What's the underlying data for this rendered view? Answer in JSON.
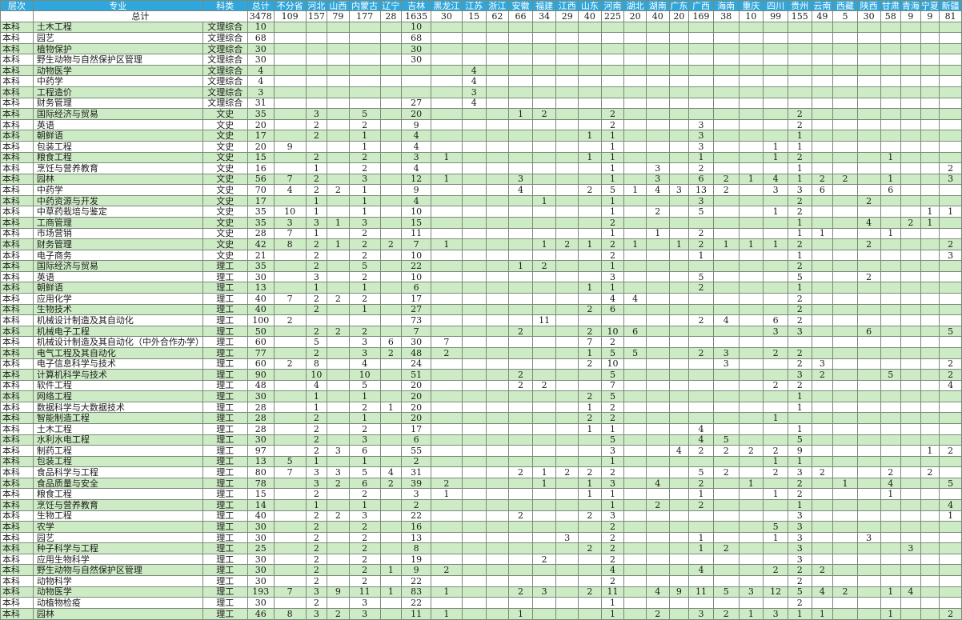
{
  "table": {
    "headers": [
      "层次",
      "专业",
      "科类",
      "总计",
      "不分省",
      "河北",
      "山西",
      "内蒙古",
      "辽宁",
      "吉林",
      "黑龙江",
      "江苏",
      "浙江",
      "安徽",
      "福建",
      "江西",
      "山东",
      "河南",
      "湖北",
      "湖南",
      "广东",
      "广西",
      "海南",
      "重庆",
      "四川",
      "贵州",
      "云南",
      "西藏",
      "陕西",
      "甘肃",
      "青海",
      "宁夏",
      "新疆"
    ],
    "total_label": "总计",
    "total_values": [
      "3478",
      "109",
      "157",
      "79",
      "177",
      "28",
      "1635",
      "30",
      "15",
      "62",
      "66",
      "34",
      "29",
      "40",
      "225",
      "20",
      "40",
      "20",
      "169",
      "38",
      "10",
      "99",
      "155",
      "49",
      "5",
      "30",
      "58",
      "9",
      "9",
      "81"
    ],
    "rows": [
      {
        "level": "本科",
        "major": "土木工程",
        "kind": "文理综合",
        "v": {
          "0": "10",
          "6": "10"
        }
      },
      {
        "level": "本科",
        "major": "园艺",
        "kind": "文理综合",
        "v": {
          "0": "68",
          "6": "68"
        }
      },
      {
        "level": "本科",
        "major": "植物保护",
        "kind": "文理综合",
        "v": {
          "0": "30",
          "6": "30"
        }
      },
      {
        "level": "本科",
        "major": "野生动物与自然保护区管理",
        "kind": "文理综合",
        "v": {
          "0": "30",
          "6": "30"
        }
      },
      {
        "level": "本科",
        "major": "动物医学",
        "kind": "文理综合",
        "v": {
          "0": "4",
          "8": "4"
        }
      },
      {
        "level": "本科",
        "major": "中药学",
        "kind": "文理综合",
        "v": {
          "0": "4",
          "8": "4"
        }
      },
      {
        "level": "本科",
        "major": "工程造价",
        "kind": "文理综合",
        "v": {
          "0": "3",
          "8": "3"
        }
      },
      {
        "level": "本科",
        "major": "财务管理",
        "kind": "文理综合",
        "v": {
          "0": "31",
          "6": "27",
          "8": "4"
        }
      },
      {
        "level": "本科",
        "major": "国际经济与贸易",
        "kind": "文史",
        "v": {
          "0": "35",
          "2": "3",
          "4": "5",
          "6": "20",
          "10": "1",
          "11": "2",
          "14": "2",
          "22": "2"
        }
      },
      {
        "level": "本科",
        "major": "英语",
        "kind": "文史",
        "v": {
          "0": "20",
          "2": "2",
          "4": "2",
          "6": "9",
          "14": "2",
          "18": "3",
          "22": "2"
        }
      },
      {
        "level": "本科",
        "major": "朝鲜语",
        "kind": "文史",
        "v": {
          "0": "17",
          "2": "2",
          "4": "1",
          "6": "4",
          "13": "1",
          "14": "1",
          "18": "3",
          "22": "1"
        }
      },
      {
        "level": "本科",
        "major": "包装工程",
        "kind": "文史",
        "v": {
          "0": "20",
          "1": "9",
          "4": "1",
          "6": "4",
          "14": "1",
          "18": "3",
          "21": "1",
          "22": "1"
        }
      },
      {
        "level": "本科",
        "major": "粮食工程",
        "kind": "文史",
        "v": {
          "0": "15",
          "2": "2",
          "4": "2",
          "6": "3",
          "7": "1",
          "13": "1",
          "14": "1",
          "18": "1",
          "21": "1",
          "22": "2",
          "26": "1"
        }
      },
      {
        "level": "本科",
        "major": "烹饪与营养教育",
        "kind": "文史",
        "v": {
          "0": "16",
          "2": "1",
          "4": "2",
          "6": "4",
          "14": "1",
          "16": "3",
          "18": "2",
          "22": "1",
          "29": "2"
        }
      },
      {
        "level": "本科",
        "major": "园林",
        "kind": "文史",
        "v": {
          "0": "56",
          "1": "7",
          "2": "2",
          "4": "3",
          "6": "12",
          "7": "1",
          "10": "3",
          "14": "1",
          "16": "3",
          "18": "6",
          "19": "2",
          "20": "1",
          "21": "4",
          "22": "1",
          "23": "2",
          "24": "2",
          "26": "1",
          "29": "3"
        }
      },
      {
        "level": "本科",
        "major": "中药学",
        "kind": "文史",
        "v": {
          "0": "70",
          "1": "4",
          "2": "2",
          "3": "2",
          "4": "1",
          "6": "9",
          "10": "4",
          "13": "2",
          "14": "5",
          "15": "1",
          "16": "4",
          "17": "3",
          "18": "13",
          "19": "2",
          "21": "3",
          "22": "3",
          "23": "6",
          "26": "6"
        }
      },
      {
        "level": "本科",
        "major": "中药资源与开发",
        "kind": "文史",
        "v": {
          "0": "17",
          "2": "1",
          "4": "1",
          "6": "4",
          "11": "1",
          "14": "1",
          "18": "3",
          "22": "2",
          "25": "2"
        }
      },
      {
        "level": "本科",
        "major": "中草药栽培与鉴定",
        "kind": "文史",
        "v": {
          "0": "35",
          "1": "10",
          "2": "1",
          "4": "1",
          "6": "10",
          "14": "1",
          "16": "2",
          "18": "5",
          "21": "1",
          "22": "2",
          "28": "1",
          "29": "1"
        }
      },
      {
        "level": "本科",
        "major": "工商管理",
        "kind": "文史",
        "v": {
          "0": "35",
          "1": "3",
          "2": "3",
          "3": "1",
          "4": "3",
          "6": "15",
          "14": "2",
          "22": "1",
          "25": "4",
          "27": "2",
          "28": "1"
        }
      },
      {
        "level": "本科",
        "major": "市场营销",
        "kind": "文史",
        "v": {
          "0": "28",
          "1": "7",
          "2": "1",
          "4": "2",
          "6": "11",
          "14": "1",
          "16": "1",
          "18": "2",
          "22": "1",
          "23": "1",
          "26": "1"
        }
      },
      {
        "level": "本科",
        "major": "财务管理",
        "kind": "文史",
        "v": {
          "0": "42",
          "1": "8",
          "2": "2",
          "3": "1",
          "4": "2",
          "5": "2",
          "6": "7",
          "7": "1",
          "11": "1",
          "12": "2",
          "13": "1",
          "14": "2",
          "15": "1",
          "17": "1",
          "18": "2",
          "19": "1",
          "20": "1",
          "21": "1",
          "22": "2",
          "25": "2",
          "29": "2"
        }
      },
      {
        "level": "本科",
        "major": "电子商务",
        "kind": "文史",
        "v": {
          "0": "21",
          "2": "2",
          "4": "2",
          "6": "10",
          "14": "2",
          "18": "1",
          "22": "1",
          "29": "3"
        }
      },
      {
        "level": "本科",
        "major": "国际经济与贸易",
        "kind": "理工",
        "v": {
          "0": "35",
          "2": "2",
          "4": "5",
          "6": "22",
          "10": "1",
          "11": "2",
          "14": "1",
          "22": "2"
        }
      },
      {
        "level": "本科",
        "major": "英语",
        "kind": "理工",
        "v": {
          "0": "30",
          "2": "3",
          "4": "2",
          "6": "10",
          "14": "3",
          "18": "5",
          "22": "5",
          "25": "2"
        }
      },
      {
        "level": "本科",
        "major": "朝鲜语",
        "kind": "理工",
        "v": {
          "0": "13",
          "2": "1",
          "4": "1",
          "6": "6",
          "13": "1",
          "14": "1",
          "18": "2",
          "22": "1"
        }
      },
      {
        "level": "本科",
        "major": "应用化学",
        "kind": "理工",
        "v": {
          "0": "40",
          "1": "7",
          "2": "2",
          "3": "2",
          "4": "2",
          "6": "17",
          "14": "4",
          "15": "4",
          "22": "2"
        }
      },
      {
        "level": "本科",
        "major": "生物技术",
        "kind": "理工",
        "v": {
          "0": "40",
          "2": "2",
          "4": "1",
          "6": "27",
          "13": "2",
          "14": "6",
          "22": "2"
        }
      },
      {
        "level": "本科",
        "major": "机械设计制造及其自动化",
        "kind": "理工",
        "v": {
          "0": "100",
          "1": "2",
          "6": "73",
          "11": "11",
          "18": "2",
          "19": "4",
          "21": "6",
          "22": "2"
        }
      },
      {
        "level": "本科",
        "major": "机械电子工程",
        "kind": "理工",
        "v": {
          "0": "50",
          "2": "2",
          "3": "2",
          "4": "2",
          "6": "7",
          "10": "2",
          "13": "2",
          "14": "10",
          "15": "6",
          "21": "3",
          "22": "3",
          "25": "6",
          "29": "5"
        }
      },
      {
        "level": "本科",
        "major": " 机械设计制造及其自动化（中外合作办学）",
        "kind": "理工",
        "v": {
          "0": "60",
          "2": "5",
          "4": "3",
          "5": "6",
          "6": "30",
          "7": "7",
          "13": "7",
          "14": "2"
        }
      },
      {
        "level": "本科",
        "major": "电气工程及其自动化",
        "kind": "理工",
        "v": {
          "0": "77",
          "2": "2",
          "4": "3",
          "5": "2",
          "6": "48",
          "7": "2",
          "13": "1",
          "14": "5",
          "15": "5",
          "18": "2",
          "19": "3",
          "21": "2",
          "22": "2"
        }
      },
      {
        "level": "本科",
        "major": "电子信息科学与技术",
        "kind": "理工",
        "v": {
          "0": "60",
          "1": "2",
          "2": "8",
          "4": "4",
          "6": "24",
          "13": "2",
          "14": "10",
          "19": "3",
          "22": "2",
          "23": "3",
          "29": "2"
        }
      },
      {
        "level": "本科",
        "major": "计算机科学与技术",
        "kind": "理工",
        "v": {
          "0": "90",
          "2": "10",
          "4": "10",
          "6": "51",
          "10": "2",
          "14": "5",
          "22": "3",
          "23": "2",
          "26": "5",
          "29": "2"
        }
      },
      {
        "level": "本科",
        "major": "软件工程",
        "kind": "理工",
        "v": {
          "0": "48",
          "2": "4",
          "4": "5",
          "6": "20",
          "10": "2",
          "11": "2",
          "14": "7",
          "21": "2",
          "22": "2",
          "29": "4"
        }
      },
      {
        "level": "本科",
        "major": "网络工程",
        "kind": "理工",
        "v": {
          "0": "30",
          "2": "1",
          "4": "1",
          "6": "20",
          "13": "2",
          "14": "5",
          "22": "1"
        }
      },
      {
        "level": "本科",
        "major": "数据科学与大数据技术",
        "kind": "理工",
        "v": {
          "0": "28",
          "2": "1",
          "4": "2",
          "5": "1",
          "6": "20",
          "13": "1",
          "14": "2",
          "22": "1"
        }
      },
      {
        "level": "本科",
        "major": "智能制造工程",
        "kind": "理工",
        "v": {
          "0": "28",
          "2": "2",
          "4": "1",
          "6": "20",
          "13": "2",
          "14": "2",
          "21": "1"
        }
      },
      {
        "level": "本科",
        "major": "土木工程",
        "kind": "理工",
        "v": {
          "0": "28",
          "2": "2",
          "4": "2",
          "6": "17",
          "13": "1",
          "14": "1",
          "18": "4",
          "22": "1"
        }
      },
      {
        "level": "本科",
        "major": "水利水电工程",
        "kind": "理工",
        "v": {
          "0": "30",
          "2": "2",
          "4": "3",
          "6": "6",
          "14": "5",
          "18": "4",
          "19": "5",
          "22": "5"
        }
      },
      {
        "level": "本科",
        "major": "制药工程",
        "kind": "理工",
        "v": {
          "0": "97",
          "2": "2",
          "3": "3",
          "4": "6",
          "6": "55",
          "14": "3",
          "17": "4",
          "18": "2",
          "19": "2",
          "20": "2",
          "21": "2",
          "22": "9",
          "28": "1",
          "29": "2"
        }
      },
      {
        "level": "本科",
        "major": "包装工程",
        "kind": "理工",
        "v": {
          "0": "13",
          "1": "5",
          "2": "1",
          "4": "1",
          "6": "2",
          "14": "1",
          "21": "1",
          "22": "1"
        }
      },
      {
        "level": "本科",
        "major": "食品科学与工程",
        "kind": "理工",
        "v": {
          "0": "80",
          "1": "7",
          "2": "3",
          "3": "3",
          "4": "5",
          "5": "4",
          "6": "31",
          "10": "2",
          "11": "1",
          "12": "2",
          "13": "2",
          "14": "2",
          "18": "5",
          "19": "2",
          "21": "2",
          "22": "3",
          "23": "2",
          "26": "2",
          "28": "2"
        }
      },
      {
        "level": "本科",
        "major": "食品质量与安全",
        "kind": "理工",
        "v": {
          "0": "78",
          "2": "3",
          "3": "2",
          "4": "6",
          "5": "2",
          "6": "39",
          "7": "2",
          "11": "1",
          "13": "1",
          "14": "3",
          "16": "4",
          "18": "2",
          "20": "1",
          "22": "2",
          "24": "1",
          "26": "4",
          "29": "5"
        }
      },
      {
        "level": "本科",
        "major": "粮食工程",
        "kind": "理工",
        "v": {
          "0": "15",
          "2": "2",
          "4": "2",
          "6": "3",
          "7": "1",
          "13": "1",
          "14": "1",
          "18": "1",
          "21": "1",
          "22": "2",
          "26": "1"
        }
      },
      {
        "level": "本科",
        "major": "烹饪与营养教育",
        "kind": "理工",
        "v": {
          "0": "14",
          "2": "1",
          "4": "1",
          "6": "2",
          "14": "1",
          "16": "2",
          "18": "2",
          "22": "1",
          "29": "4"
        }
      },
      {
        "level": "本科",
        "major": "生物工程",
        "kind": "理工",
        "v": {
          "0": "40",
          "2": "2",
          "3": "2",
          "4": "3",
          "6": "22",
          "10": "2",
          "13": "2",
          "14": "3",
          "22": "3",
          "29": "1"
        }
      },
      {
        "level": "本科",
        "major": "农学",
        "kind": "理工",
        "v": {
          "0": "30",
          "2": "2",
          "4": "2",
          "6": "16",
          "14": "2",
          "21": "5",
          "22": "3"
        }
      },
      {
        "level": "本科",
        "major": "园艺",
        "kind": "理工",
        "v": {
          "0": "30",
          "2": "2",
          "4": "2",
          "6": "13",
          "12": "3",
          "14": "2",
          "18": "1",
          "21": "1",
          "22": "3",
          "25": "3"
        }
      },
      {
        "level": "本科",
        "major": "种子科学与工程",
        "kind": "理工",
        "v": {
          "0": "25",
          "2": "2",
          "4": "2",
          "6": "8",
          "13": "2",
          "14": "2",
          "18": "1",
          "19": "2",
          "22": "3",
          "27": "3"
        }
      },
      {
        "level": "本科",
        "major": "应用生物科学",
        "kind": "理工",
        "v": {
          "0": "30",
          "2": "2",
          "4": "2",
          "6": "19",
          "11": "2",
          "14": "2",
          "22": "3"
        }
      },
      {
        "level": "本科",
        "major": "野生动物与自然保护区管理",
        "kind": "理工",
        "v": {
          "0": "30",
          "2": "2",
          "4": "2",
          "5": "1",
          "6": "9",
          "7": "2",
          "14": "4",
          "18": "4",
          "21": "2",
          "22": "2",
          "23": "2"
        }
      },
      {
        "level": "本科",
        "major": "动物科学",
        "kind": "理工",
        "v": {
          "0": "30",
          "2": "2",
          "4": "2",
          "6": "22",
          "14": "2",
          "22": "2"
        }
      },
      {
        "level": "本科",
        "major": "动物医学",
        "kind": "理工",
        "v": {
          "0": "193",
          "1": "7",
          "2": "3",
          "3": "9",
          "4": "11",
          "5": "1",
          "6": "83",
          "7": "1",
          "10": "2",
          "11": "3",
          "13": "2",
          "14": "11",
          "16": "4",
          "17": "9",
          "18": "11",
          "19": "5",
          "20": "3",
          "21": "12",
          "22": "5",
          "23": "4",
          "24": "2",
          "26": "1",
          "27": "4"
        }
      },
      {
        "level": "本科",
        "major": "动植物检疫",
        "kind": "理工",
        "v": {
          "0": "30",
          "2": "2",
          "4": "3",
          "6": "22",
          "14": "1",
          "22": "2"
        }
      },
      {
        "level": "本科",
        "major": "园林",
        "kind": "理工",
        "v": {
          "0": "46",
          "1": "8",
          "2": "3",
          "3": "2",
          "4": "3",
          "6": "11",
          "7": "1",
          "10": "1",
          "14": "1",
          "16": "2",
          "18": "3",
          "19": "2",
          "20": "1",
          "21": "3",
          "22": "1",
          "23": "1",
          "26": "1",
          "29": "2"
        }
      }
    ]
  }
}
